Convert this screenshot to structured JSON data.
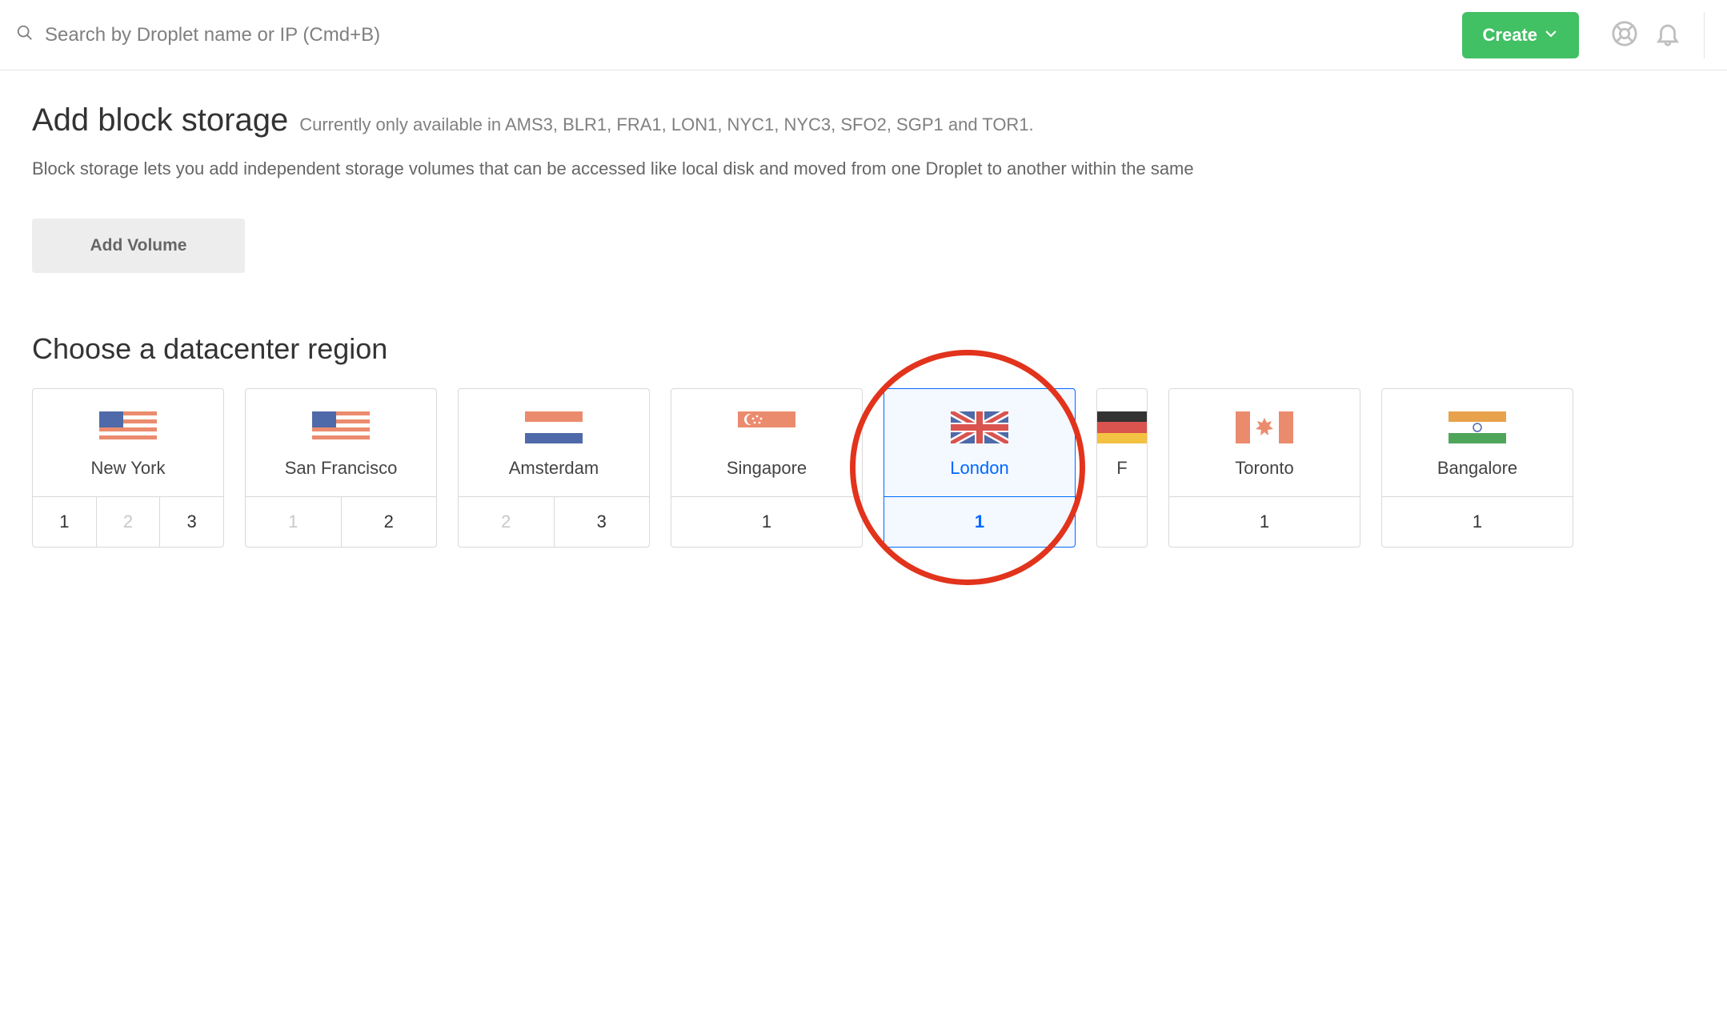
{
  "topbar": {
    "search_placeholder": "Search by Droplet name or IP (Cmd+B)",
    "create_label": "Create"
  },
  "block_storage": {
    "title": "Add block storage",
    "availability": "Currently only available in AMS3, BLR1, FRA1, LON1, NYC1, NYC3, SFO2, SGP1 and TOR1.",
    "description": "Block storage lets you add independent storage volumes that can be accessed like local disk and moved from one Droplet to another within the same",
    "add_volume_label": "Add Volume"
  },
  "region_section": {
    "title": "Choose a datacenter region"
  },
  "regions": [
    {
      "id": "nyc",
      "name": "New York",
      "flag": "us",
      "slots": [
        {
          "n": "1",
          "enabled": true
        },
        {
          "n": "2",
          "enabled": false
        },
        {
          "n": "3",
          "enabled": true
        }
      ],
      "selected": false
    },
    {
      "id": "sfo",
      "name": "San Francisco",
      "flag": "us",
      "slots": [
        {
          "n": "1",
          "enabled": false
        },
        {
          "n": "2",
          "enabled": true
        }
      ],
      "selected": false
    },
    {
      "id": "ams",
      "name": "Amsterdam",
      "flag": "nl",
      "slots": [
        {
          "n": "2",
          "enabled": false
        },
        {
          "n": "3",
          "enabled": true
        }
      ],
      "selected": false
    },
    {
      "id": "sgp",
      "name": "Singapore",
      "flag": "sg",
      "slots": [
        {
          "n": "1",
          "enabled": true
        }
      ],
      "selected": false
    },
    {
      "id": "lon",
      "name": "London",
      "flag": "gb",
      "slots": [
        {
          "n": "1",
          "enabled": true,
          "active": true
        }
      ],
      "selected": true
    },
    {
      "id": "fra",
      "name": "F",
      "flag": "de",
      "slots": [
        {
          "n": "",
          "enabled": true
        }
      ],
      "selected": false,
      "peek": true
    },
    {
      "id": "tor",
      "name": "Toronto",
      "flag": "ca",
      "slots": [
        {
          "n": "1",
          "enabled": true
        }
      ],
      "selected": false
    },
    {
      "id": "blr",
      "name": "Bangalore",
      "flag": "in",
      "slots": [
        {
          "n": "1",
          "enabled": true
        }
      ],
      "selected": false
    }
  ],
  "annotation": {
    "highlights": "lon"
  }
}
